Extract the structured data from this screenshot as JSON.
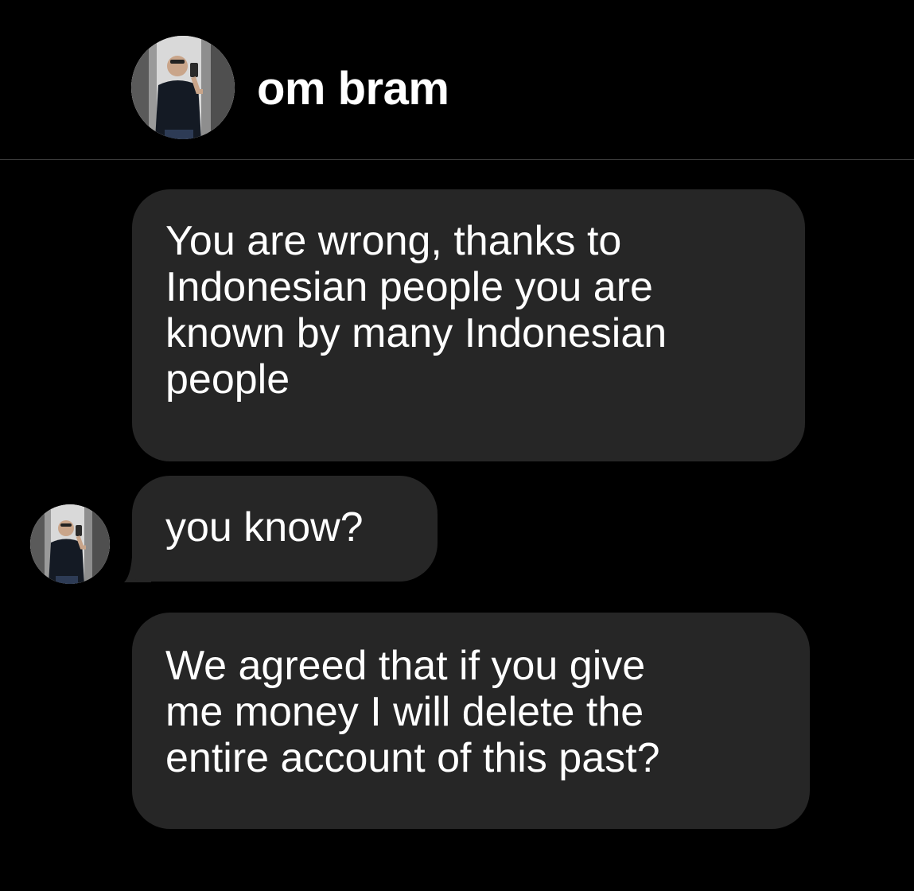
{
  "header": {
    "contact_name": "om bram",
    "avatar_icon": "profile-photo-icon"
  },
  "messages": [
    {
      "text": "You are wrong, thanks to\nIndonesian people you are\nknown by many Indonesian\npeople",
      "direction": "incoming"
    },
    {
      "text": "you know?",
      "direction": "incoming"
    },
    {
      "text": "We agreed that if you give\nme money I will delete the\nentire account of this past?",
      "direction": "incoming"
    }
  ],
  "colors": {
    "background": "#000000",
    "bubble": "#262626",
    "text": "#ffffff",
    "divider": "#3a3a3a"
  }
}
